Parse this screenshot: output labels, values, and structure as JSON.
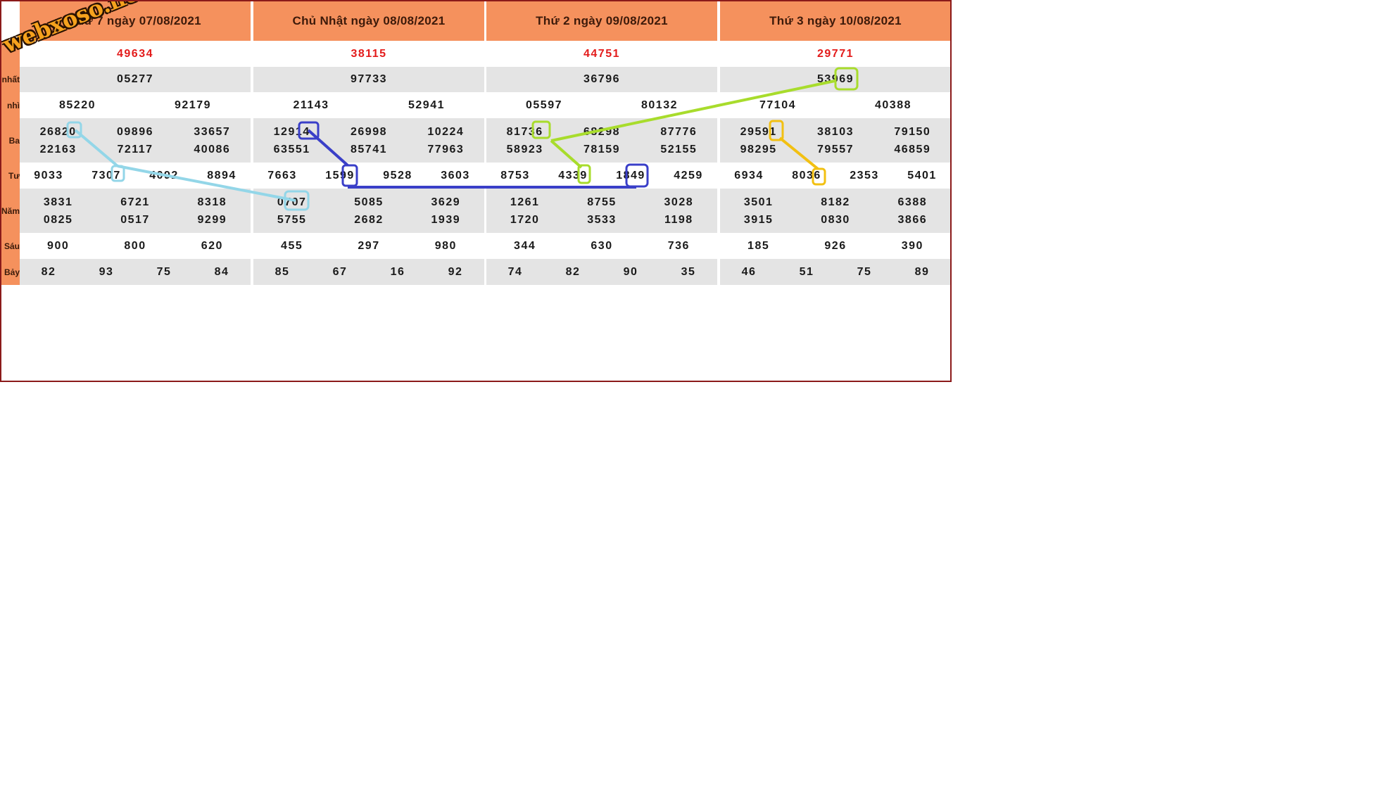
{
  "row_labels": [
    "nhất",
    "nhì",
    "Ba",
    "Tư",
    "Năm",
    "Sáu",
    "Bảy"
  ],
  "watermark": "webxoso.net",
  "days": [
    {
      "title": "Thứ 7 ngày 07/08/2021",
      "special": [
        "49634"
      ],
      "first": [
        "05277"
      ],
      "second": [
        "85220",
        "92179"
      ],
      "third": [
        "26820",
        "09896",
        "33657",
        "22163",
        "72117",
        "40086"
      ],
      "fourth": [
        "9033",
        "7307",
        "4092",
        "8894"
      ],
      "fifth": [
        "3831",
        "6721",
        "8318",
        "0825",
        "0517",
        "9299"
      ],
      "sixth": [
        "900",
        "800",
        "620"
      ],
      "seventh": [
        "82",
        "93",
        "75",
        "84"
      ]
    },
    {
      "title": "Chủ Nhật ngày 08/08/2021",
      "special": [
        "38115"
      ],
      "first": [
        "97733"
      ],
      "second": [
        "21143",
        "52941"
      ],
      "third": [
        "12914",
        "26998",
        "10224",
        "63551",
        "85741",
        "77963"
      ],
      "fourth": [
        "7663",
        "1599",
        "9528",
        "3603"
      ],
      "fifth": [
        "0707",
        "5085",
        "3629",
        "5755",
        "2682",
        "1939"
      ],
      "sixth": [
        "455",
        "297",
        "980"
      ],
      "seventh": [
        "85",
        "67",
        "16",
        "92"
      ]
    },
    {
      "title": "Thứ 2 ngày 09/08/2021",
      "special": [
        "44751"
      ],
      "first": [
        "36796"
      ],
      "second": [
        "05597",
        "80132"
      ],
      "third": [
        "81736",
        "68298",
        "87776",
        "58923",
        "78159",
        "52155"
      ],
      "fourth": [
        "8753",
        "4339",
        "1849",
        "4259"
      ],
      "fifth": [
        "1261",
        "8755",
        "3028",
        "1720",
        "3533",
        "1198"
      ],
      "sixth": [
        "344",
        "630",
        "736"
      ],
      "seventh": [
        "74",
        "82",
        "90",
        "35"
      ]
    },
    {
      "title": "Thứ 3 ngày 10/08/2021",
      "special": [
        "29771"
      ],
      "first": [
        "53969"
      ],
      "second": [
        "77104",
        "40388"
      ],
      "third": [
        "29591",
        "38103",
        "79150",
        "98295",
        "79557",
        "46859"
      ],
      "fourth": [
        "6934",
        "8036",
        "2353",
        "5401"
      ],
      "fifth": [
        "3501",
        "8182",
        "6388",
        "3915",
        "0830",
        "3866"
      ],
      "sixth": [
        "185",
        "926",
        "390"
      ],
      "seventh": [
        "46",
        "51",
        "75",
        "89"
      ]
    }
  ],
  "highlight_colors": {
    "light_blue": "#93d6e8",
    "dark_blue": "#3a3fc8",
    "lime": "#a8dc2c",
    "gold": "#f2c012"
  }
}
